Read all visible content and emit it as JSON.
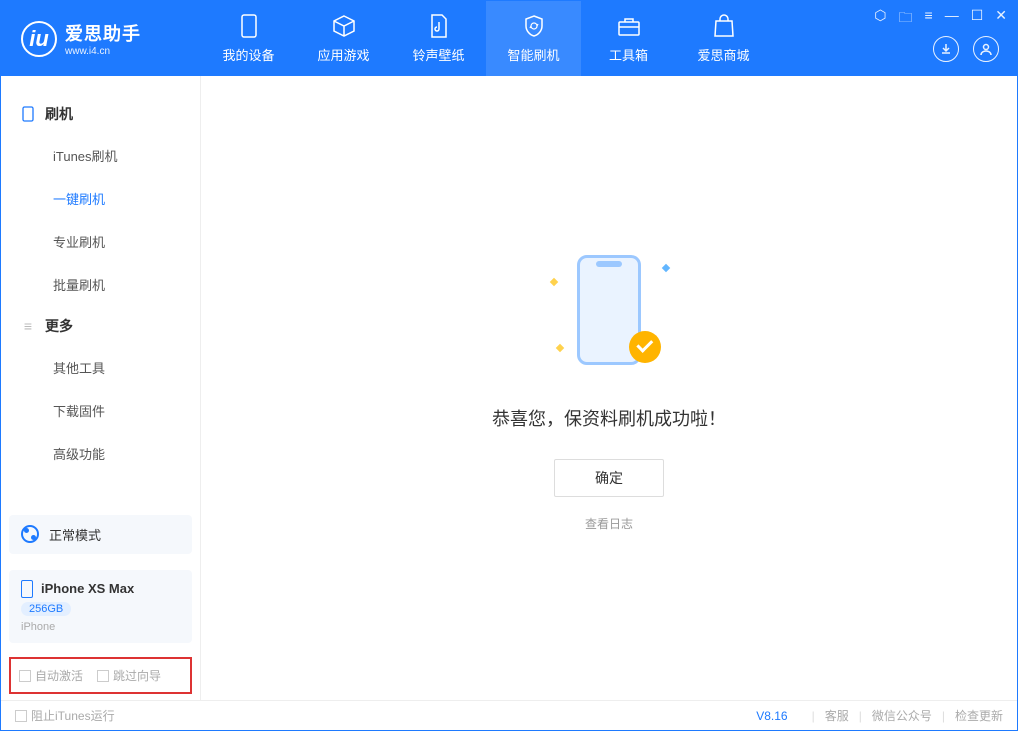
{
  "app": {
    "name_cn": "爱思助手",
    "name_en": "www.i4.cn"
  },
  "nav": {
    "tabs": [
      {
        "label": "我的设备"
      },
      {
        "label": "应用游戏"
      },
      {
        "label": "铃声壁纸"
      },
      {
        "label": "智能刷机"
      },
      {
        "label": "工具箱"
      },
      {
        "label": "爱思商城"
      }
    ]
  },
  "sidebar": {
    "section1_title": "刷机",
    "items1": [
      {
        "label": "iTunes刷机"
      },
      {
        "label": "一键刷机"
      },
      {
        "label": "专业刷机"
      },
      {
        "label": "批量刷机"
      }
    ],
    "section2_title": "更多",
    "items2": [
      {
        "label": "其他工具"
      },
      {
        "label": "下载固件"
      },
      {
        "label": "高级功能"
      }
    ]
  },
  "device": {
    "mode_label": "正常模式",
    "name": "iPhone XS Max",
    "capacity": "256GB",
    "type": "iPhone"
  },
  "options": {
    "auto_activate": "自动激活",
    "skip_guide": "跳过向导"
  },
  "main": {
    "success_text": "恭喜您，保资料刷机成功啦！",
    "ok_label": "确定",
    "log_link": "查看日志"
  },
  "footer": {
    "block_itunes": "阻止iTunes运行",
    "version": "V8.16",
    "support": "客服",
    "wechat": "微信公众号",
    "update": "检查更新"
  }
}
